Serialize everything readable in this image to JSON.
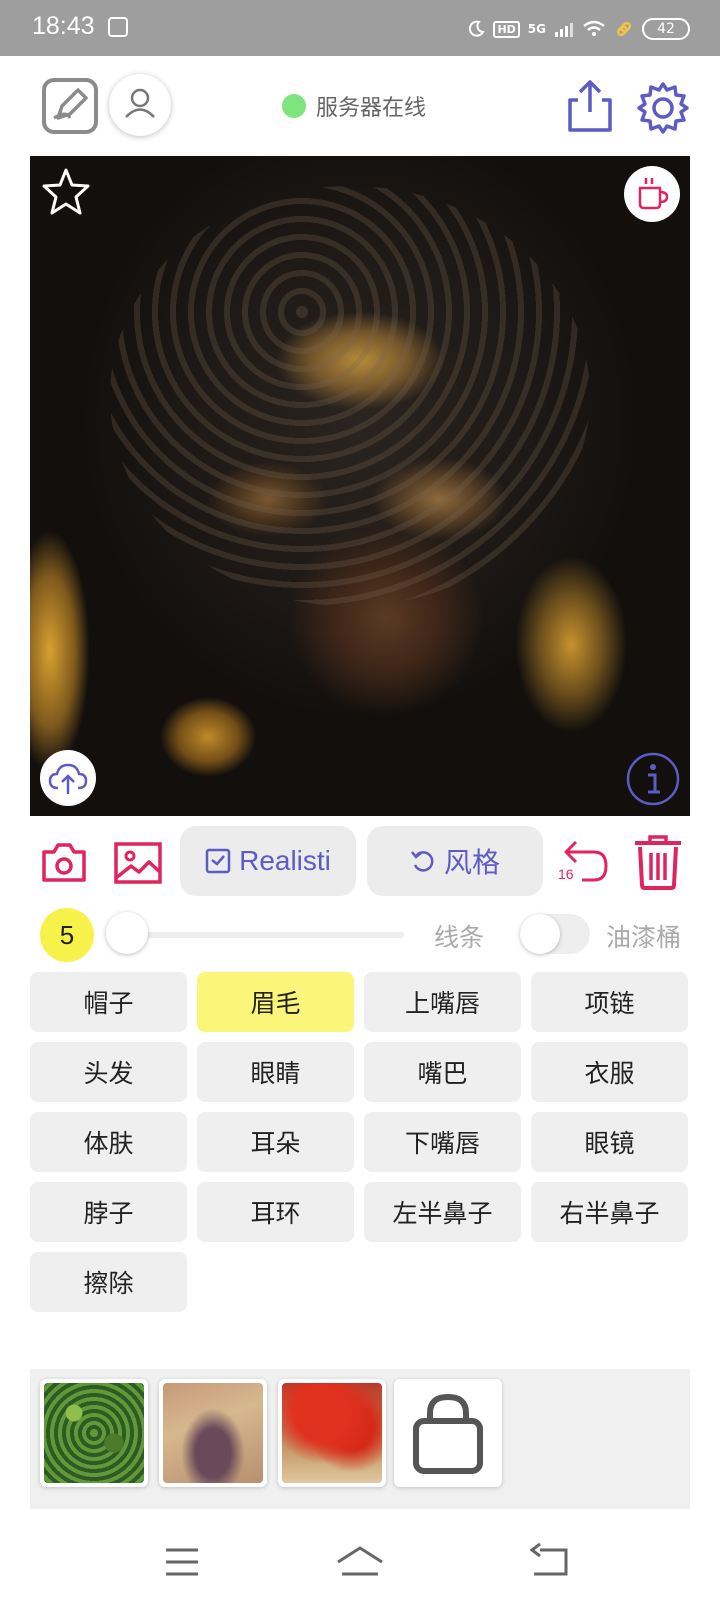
{
  "status_bar": {
    "time": "18:43",
    "network": "5G",
    "hd_badge": "HD",
    "battery": "42"
  },
  "header": {
    "server_status": "服务器在线",
    "server_status_color": "#7ee47e"
  },
  "icons": {
    "edit": "edit-icon",
    "user": "user-icon",
    "share": "share-icon",
    "settings": "gear-icon",
    "favorite": "star-icon",
    "cup": "cup-icon",
    "upload": "cloud-upload-icon",
    "info": "info-icon",
    "camera": "camera-icon",
    "gallery": "image-icon",
    "undo": "undo-icon",
    "trash": "trash-icon",
    "shop": "shopping-bag-icon"
  },
  "toolbar": {
    "realistic_label": "Realisti",
    "style_label": "风格",
    "undo_count": "16"
  },
  "brush": {
    "size": "5",
    "lines_label": "线条",
    "bucket_label": "油漆桶"
  },
  "parts": [
    {
      "label": "帽子",
      "selected": false
    },
    {
      "label": "眉毛",
      "selected": true
    },
    {
      "label": "上嘴唇",
      "selected": false
    },
    {
      "label": "项链",
      "selected": false
    },
    {
      "label": "头发",
      "selected": false
    },
    {
      "label": "眼睛",
      "selected": false
    },
    {
      "label": "嘴巴",
      "selected": false
    },
    {
      "label": "衣服",
      "selected": false
    },
    {
      "label": "体肤",
      "selected": false
    },
    {
      "label": "耳朵",
      "selected": false
    },
    {
      "label": "下嘴唇",
      "selected": false
    },
    {
      "label": "眼镜",
      "selected": false
    },
    {
      "label": "脖子",
      "selected": false
    },
    {
      "label": "耳环",
      "selected": false
    },
    {
      "label": "左半鼻子",
      "selected": false
    },
    {
      "label": "右半鼻子",
      "selected": false
    },
    {
      "label": "擦除",
      "selected": false
    }
  ],
  "colors": {
    "accent": "#5d5cc4",
    "danger": "#e0245e",
    "selected": "#fbf67a"
  }
}
